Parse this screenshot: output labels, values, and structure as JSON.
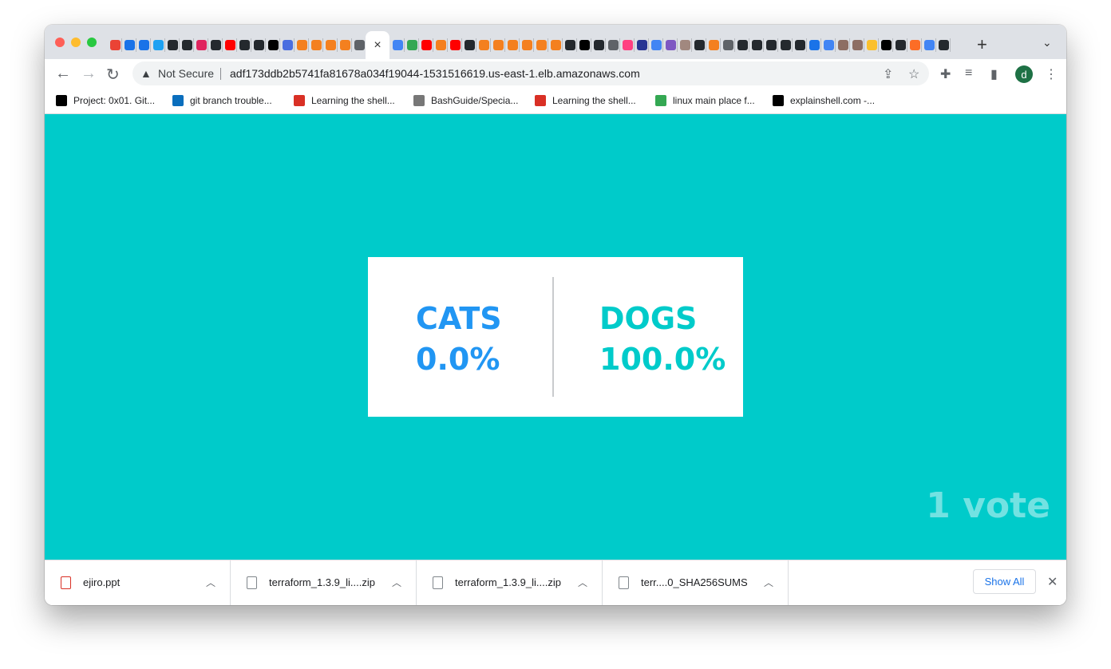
{
  "browser": {
    "tab_icon_colors": [
      "#ea4335",
      "#1a73e8",
      "#1a73e8",
      "#1da1f2",
      "#24292e",
      "#24292e",
      "#e0245e",
      "#24292e",
      "#ff0000",
      "#24292e",
      "#24292e",
      "#000000",
      "#4a6ee0",
      "#f4801f",
      "#f4801f",
      "#f4801f",
      "#f4801f",
      "#5f6368"
    ],
    "tab_icon_colors_right": [
      "#4285f4",
      "#34a853",
      "#ff0000",
      "#f4801f",
      "#ff0000",
      "#24292e",
      "#f4801f",
      "#f4801f",
      "#f4801f",
      "#f4801f",
      "#f4801f",
      "#f4801f",
      "#24292e",
      "#000000",
      "#24292e",
      "#5f6368",
      "#ff4081",
      "#283593",
      "#4285f4",
      "#7e57c2",
      "#a1887f",
      "#24292e",
      "#f4801f",
      "#5f6368",
      "#24292e",
      "#24292e",
      "#24292e",
      "#24292e",
      "#24292e",
      "#1a73e8",
      "#4285f4",
      "#8d6e63",
      "#8d6e63",
      "#fbc02d",
      "#000000",
      "#24292e",
      "#fc6d26",
      "#4285f4",
      "#24292e"
    ],
    "active_tab_close": "×",
    "new_tab": "+",
    "tab_search": "⌄",
    "security_label": "Not Secure",
    "url": "adf173ddb2b5741fa81678a034f19044-1531516619.us-east-1.elb.amazonaws.com",
    "avatar_letter": "d",
    "bookmarks": [
      {
        "label": "Project: 0x01. Git...",
        "icon": "alx-icon",
        "color": "#000000"
      },
      {
        "label": "git branch trouble...",
        "icon": "git-icon",
        "color": "#0a6ebd"
      },
      {
        "label": "Learning the shell...",
        "icon": "page-icon",
        "color": "#d93025"
      },
      {
        "label": "BashGuide/Specia...",
        "icon": "bash-icon",
        "color": "#777777"
      },
      {
        "label": "Learning the shell...",
        "icon": "page-icon",
        "color": "#d93025"
      },
      {
        "label": "linux main place f...",
        "icon": "leaf-icon",
        "color": "#34a853"
      },
      {
        "label": "explainshell.com -...",
        "icon": "shell-icon",
        "color": "#000000"
      }
    ]
  },
  "page": {
    "background_color": "#00cbca",
    "option_a": {
      "name": "CATS",
      "percent": "0.0%",
      "color": "#2196f3"
    },
    "option_b": {
      "name": "DOGS",
      "percent": "100.0%",
      "color": "#00cbca"
    },
    "vote_count": "1 vote"
  },
  "downloads": {
    "items": [
      {
        "name": "ejiro.ppt",
        "icon": "ppt-icon"
      },
      {
        "name": "terraform_1.3.9_li....zip",
        "icon": "zip-icon"
      },
      {
        "name": "terraform_1.3.9_li....zip",
        "icon": "zip-icon"
      },
      {
        "name": "terr....0_SHA256SUMS",
        "icon": "file-icon"
      }
    ],
    "show_all": "Show All",
    "close": "✕"
  }
}
